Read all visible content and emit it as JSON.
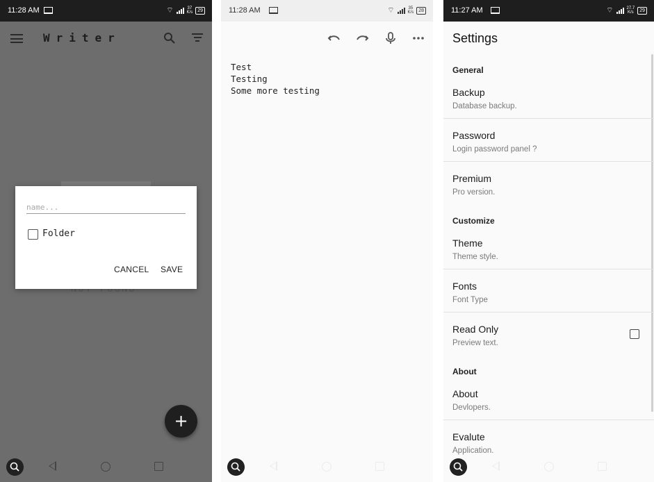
{
  "status_bars": {
    "p1_time": "11:28 AM",
    "p1_speed_top": "37",
    "p1_speed_bottom": "K/s",
    "p1_battery": "29",
    "p2_time": "11:28 AM",
    "p2_speed_top": "35",
    "p2_speed_bottom": "K/s",
    "p2_battery": "28",
    "p3_time": "11:27 AM",
    "p3_speed_top": "27.7",
    "p3_speed_bottom": "K/s",
    "p3_battery": "29"
  },
  "writer": {
    "title": "Writer",
    "background_text": "NOT FOUND",
    "dialog": {
      "name_placeholder": "name...",
      "folder_label": "Folder",
      "cancel_label": "CANCEL",
      "save_label": "SAVE"
    },
    "fab_label": "+"
  },
  "editor": {
    "lines": [
      "Test",
      "Testing",
      "Some more testing"
    ]
  },
  "settings": {
    "title": "Settings",
    "sections": [
      {
        "header": "General",
        "items": [
          {
            "title": "Backup",
            "subtitle": "Database backup."
          },
          {
            "title": "Password",
            "subtitle": "Login password panel ?"
          },
          {
            "title": "Premium",
            "subtitle": "Pro version."
          }
        ]
      },
      {
        "header": "Customize",
        "items": [
          {
            "title": "Theme",
            "subtitle": "Theme style."
          },
          {
            "title": "Fonts",
            "subtitle": "Font Type"
          },
          {
            "title": "Read Only",
            "subtitle": "Preview text.",
            "checked": false
          }
        ]
      },
      {
        "header": "About",
        "items": [
          {
            "title": "About",
            "subtitle": "Devlopers."
          },
          {
            "title": "Evalute",
            "subtitle": "Application."
          }
        ]
      }
    ]
  },
  "icons": [
    "menu-icon",
    "search-icon",
    "filter-icon",
    "undo-icon",
    "redo-icon",
    "mic-icon",
    "more-icon",
    "zoom-icon",
    "back-icon",
    "home-icon",
    "recents-icon",
    "wifi-icon",
    "signal-icon",
    "laptop-icon"
  ],
  "colors": {
    "dim_overlay": "#6d6d6d",
    "fab": "#1f1f1f",
    "surface": "#fafafa"
  }
}
